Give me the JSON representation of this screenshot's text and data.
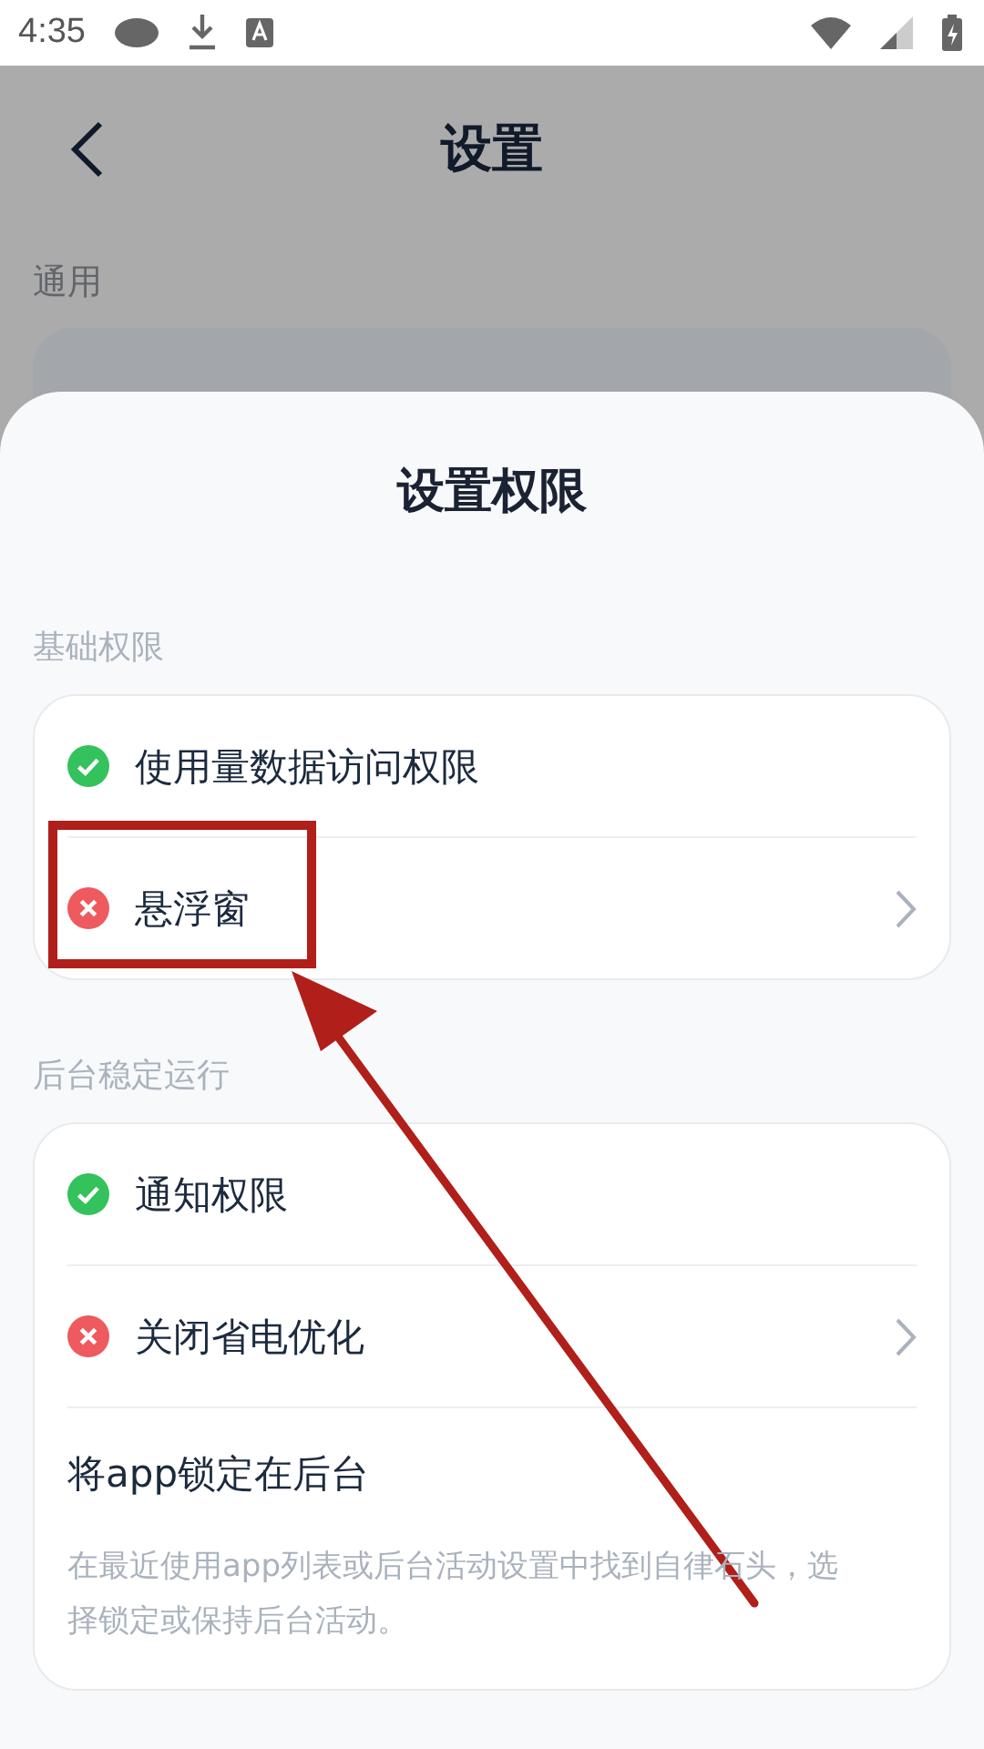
{
  "status_bar": {
    "time": "4:35"
  },
  "background_screen": {
    "title": "设置",
    "section_label": "通用"
  },
  "sheet": {
    "title": "设置权限",
    "sections": [
      {
        "label": "基础权限",
        "items": [
          {
            "kind": "permission",
            "label": "使用量数据访问权限",
            "granted": true,
            "has_arrow": false
          },
          {
            "kind": "permission",
            "label": "悬浮窗",
            "granted": false,
            "has_arrow": true
          }
        ]
      },
      {
        "label": "后台稳定运行",
        "items": [
          {
            "kind": "permission",
            "label": "通知权限",
            "granted": true,
            "has_arrow": false
          },
          {
            "kind": "permission",
            "label": "关闭省电优化",
            "granted": false,
            "has_arrow": true
          },
          {
            "kind": "info",
            "label": "将app锁定在后台",
            "description": "在最近使用app列表或后台活动设置中找到自律石头，选择锁定或保持后台活动。"
          }
        ]
      }
    ]
  }
}
